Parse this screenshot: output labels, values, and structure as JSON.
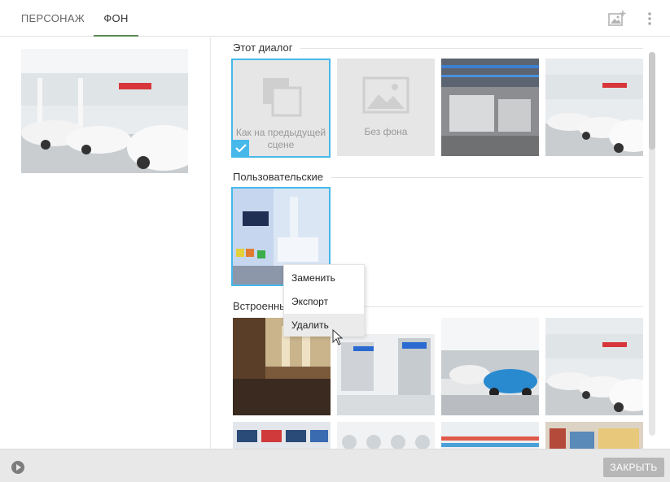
{
  "tabs": [
    {
      "label": "ПЕРСОНАЖ",
      "active": false
    },
    {
      "label": "ФОН",
      "active": true
    }
  ],
  "header_icons": {
    "add_image": "add-image-icon",
    "more": "more-vertical-icon"
  },
  "sections": {
    "this_dialog": {
      "title": "Этот диалог",
      "tiles": [
        {
          "label": "Как на предыдущей сцене",
          "selected": true,
          "icon": "layers-icon"
        },
        {
          "label": "Без фона",
          "selected": false,
          "icon": "image-icon"
        },
        {
          "label": "",
          "image": "factory-interior"
        },
        {
          "label": "",
          "image": "car-showroom"
        }
      ]
    },
    "custom": {
      "title": "Пользовательские",
      "tiles": [
        {
          "label": "",
          "image": "office-lobby",
          "selected": true
        }
      ]
    },
    "builtin": {
      "title": "Встроенные",
      "tiles": [
        {
          "image": "street-arcade"
        },
        {
          "image": "electronics-store"
        },
        {
          "image": "car-dealership"
        },
        {
          "image": "car-showroom"
        },
        {
          "image": "tv-store"
        },
        {
          "image": "appliance-store"
        },
        {
          "image": "supermarket-shelves"
        },
        {
          "image": "shop-interior"
        }
      ]
    }
  },
  "context_menu": {
    "items": [
      {
        "label": "Заменить"
      },
      {
        "label": "Экспорт"
      },
      {
        "label": "Удалить",
        "hovered": true
      }
    ]
  },
  "footer": {
    "close_label": "ЗАКРЫТЬ",
    "play_icon": "play-icon"
  },
  "colors": {
    "accent": "#46b8ea",
    "tab_indicator": "#5b8a54",
    "close_button": "#b7b7b7"
  }
}
